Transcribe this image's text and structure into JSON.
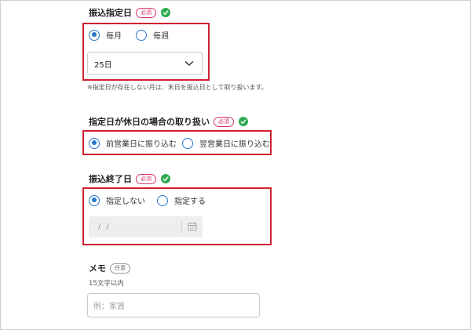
{
  "badges": {
    "required": "必須",
    "optional": "任意"
  },
  "transfer_day": {
    "title": "振込指定日",
    "options": [
      "毎月",
      "毎週"
    ],
    "selected_value": "25日",
    "note": "※指定日が存在しない月は、末日を振込日として取り扱います。"
  },
  "holiday_handling": {
    "title": "指定日が休日の場合の取り扱い",
    "options": [
      "前営業日に振り込む",
      "翌営業日に振り込む"
    ]
  },
  "end_date": {
    "title": "振込終了日",
    "options": [
      "指定しない",
      "指定する"
    ],
    "date_placeholder": "/  /"
  },
  "memo": {
    "title": "メモ",
    "hint": "15文字以内",
    "placeholder": "例：家賃"
  },
  "colors": {
    "accent": "#2878cc",
    "required_badge": "#d6336c",
    "check": "#2eaa4f",
    "highlight_box": "#d0202e"
  }
}
